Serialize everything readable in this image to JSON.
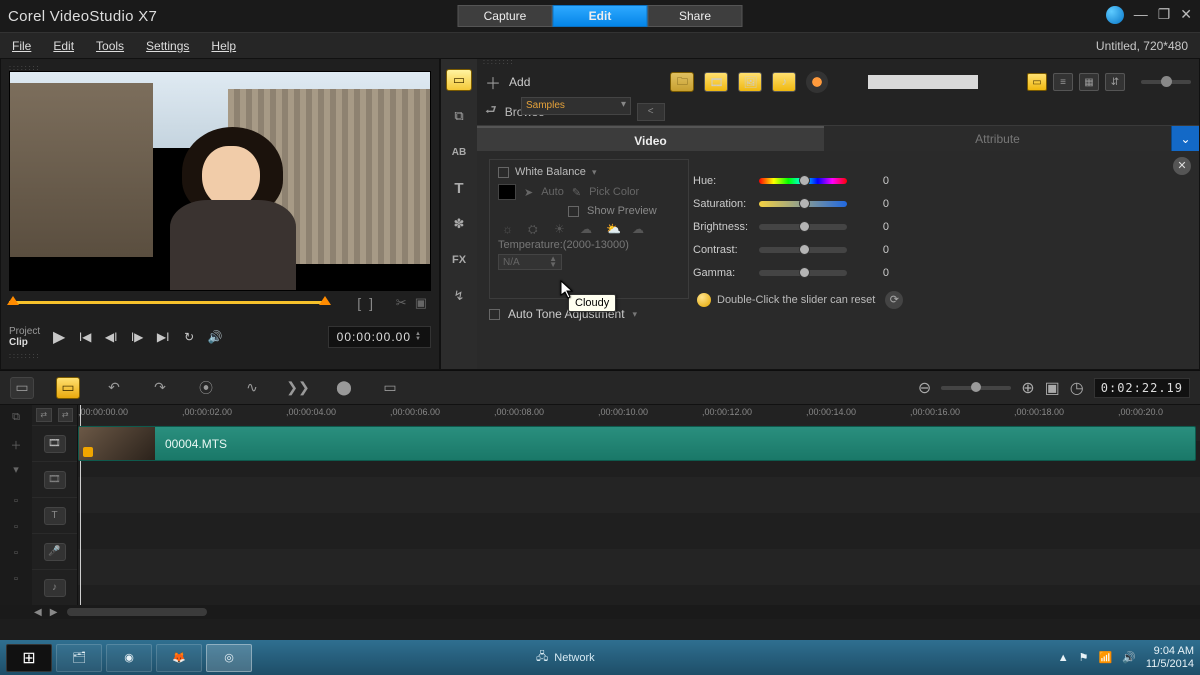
{
  "app": {
    "title": "Corel  VideoStudio X7"
  },
  "modes": {
    "capture": "Capture",
    "edit": "Edit",
    "share": "Share",
    "active": "edit"
  },
  "menu": {
    "file": "File",
    "edit": "Edit",
    "tools": "Tools",
    "settings": "Settings",
    "help": "Help"
  },
  "project_info": "Untitled, 720*480",
  "preview": {
    "toggle_project": "Project",
    "toggle_clip": "Clip",
    "mark_in": "[",
    "mark_out": "]",
    "timecode": "00:00:00.00"
  },
  "library": {
    "add_label": "Add",
    "browse_label": "Browse",
    "dropdown": "Samples"
  },
  "attr_tabs": {
    "video": "Video",
    "attribute": "Attribute"
  },
  "video_opts": {
    "white_balance": "White Balance",
    "auto": "Auto",
    "pick_color": "Pick Color",
    "show_preview": "Show Preview",
    "temperature_label": "Temperature:(2000-13000)",
    "temperature_value": "N/A",
    "auto_tone": "Auto Tone Adjustment",
    "tooltip": "Cloudy",
    "sliders": [
      {
        "label": "Hue:",
        "value": "0"
      },
      {
        "label": "Saturation:",
        "value": "0"
      },
      {
        "label": "Brightness:",
        "value": "0"
      },
      {
        "label": "Contrast:",
        "value": "0"
      },
      {
        "label": "Gamma:",
        "value": "0"
      }
    ],
    "hint": "Double-Click the slider can reset"
  },
  "timeline": {
    "duration": "0:02:22.19",
    "ruler": [
      ",00:00:00.00",
      ",00:00:02.00",
      ",00:00:04.00",
      ",00:00:06.00",
      ",00:00:08.00",
      ",00:00:10.00",
      ",00:00:12.00",
      ",00:00:14.00",
      ",00:00:16.00",
      ",00:00:18.00",
      ",00:00:20.0"
    ],
    "clip_name": "00004.MTS"
  },
  "taskbar": {
    "network": "Network",
    "time": "9:04 AM",
    "date": "11/5/2014"
  }
}
